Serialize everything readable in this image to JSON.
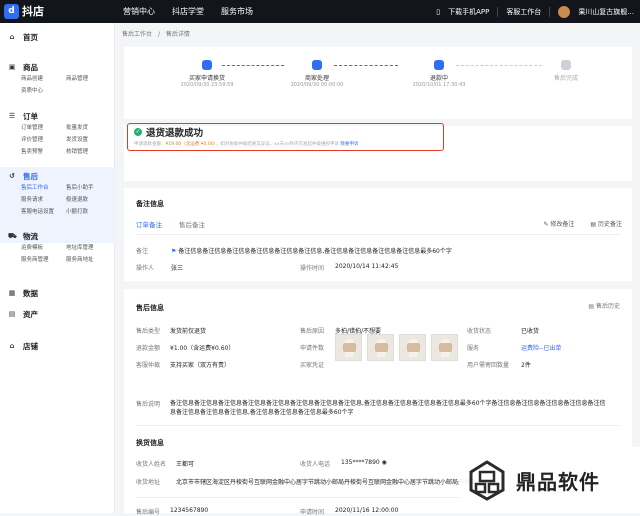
{
  "topbar": {
    "logo_mark": "d",
    "logo": "抖店",
    "nav": [
      "营销中心",
      "抖店学堂",
      "服务市场"
    ],
    "download": "下载手机APP",
    "workbench": "客服工作台",
    "shop": "果川山复古旗舰..."
  },
  "sidebar": {
    "home": "首页",
    "goods": {
      "title": "商品",
      "items": [
        "商品创建",
        "商品管理",
        "资质中心"
      ]
    },
    "orders": {
      "title": "订单",
      "items": [
        "订单管理",
        "批量发货",
        "评价管理",
        "发货设置",
        "售卖预警",
        "核销管理"
      ]
    },
    "after": {
      "title": "售后",
      "items": [
        "售后工作台",
        "售后小助手",
        "服务请求",
        "极速退款",
        "客服电话设置",
        "小额打款"
      ]
    },
    "logistics": {
      "title": "物流",
      "items": [
        "运费模板",
        "地址库管理",
        "服务商管理",
        "服务商地址"
      ]
    },
    "data": "数据",
    "assets": "资产",
    "store": "店铺"
  },
  "breadcrumb": {
    "parent": "售后工作台",
    "sep": "/",
    "current": "售后详情"
  },
  "steps": [
    {
      "title": "买家申请换货",
      "date": "2020/09/30 23:59:59"
    },
    {
      "title": "商家处理",
      "date": "2020/09/30 00:00:00"
    },
    {
      "title": "退款中",
      "date": "2020/10/01 17:30:43"
    },
    {
      "title": "售后完成",
      "date": ""
    }
  ],
  "status": {
    "title": "退货退款成功",
    "desc_prefix": "申请退款金额：",
    "amount": "¥19.00（含运费 ¥0.00）",
    "desc_suffix": "，如对协助仲裁结果又异议，xx天xx秒内可发起仲裁维权申诉",
    "link": "我要申诉"
  },
  "notes": {
    "title": "备注信息",
    "tabs": [
      "订单备注",
      "售后备注"
    ],
    "edit": "修改备注",
    "history": "历史备注",
    "remark_label": "备注",
    "remark": "备注信息备注信息备注信息备注信息备注信息备注信息,备注信息备注信息备注信息备注信息最多60个字",
    "operator_label": "操作人",
    "operator": "张三",
    "optime_label": "操作时间",
    "optime": "2020/10/14  11:42:45"
  },
  "info": {
    "title": "售后信息",
    "history": "售后历史",
    "type_label": "售后类型",
    "type": "发货前仅退货",
    "reason_label": "售后原因",
    "reason": "多拍/错拍/不想要",
    "recv_label": "收货状态",
    "recv": "已收货",
    "amount_label": "退款金额",
    "amount": "¥1.00（含运费¥0.60）",
    "count_label": "申请件数",
    "count": "2件",
    "service_label": "服务",
    "service": "运费险--已出单",
    "negotiate_label": "客服仲裁",
    "negotiate": "支持买家（双方有责）",
    "proof_label": "买家凭证",
    "user_return_label": "用户需寄回数量",
    "user_return": "2件",
    "desc_label": "售后说明",
    "desc": "备注信息备注信息备注信息备注信息备注信息备注信息备注信息备注信息,备注信息备注信息备注信息备注信息最多60个字备注信息备注信息备注信息备注信息备注信息备注信息备注信息备注信息,备注信息备注信息备注信息最多60个字"
  },
  "exchange": {
    "title": "换货信息",
    "name_label": "收货人姓名",
    "name": "王都可",
    "phone_label": "收货人电话",
    "phone": "135****7890",
    "addr_label": "收货地址",
    "addr": "北京市市辖区海淀区丹棱街号互联网金融中心居字节跳动小邮局丹棱街号互联网金融中心居字节跳动小邮局丹棱街",
    "no_label": "售后编号",
    "no": "1234567890",
    "time_label": "申请时间",
    "time": "2020/11/16 12:00:00"
  },
  "watermark": "鼎品软件"
}
